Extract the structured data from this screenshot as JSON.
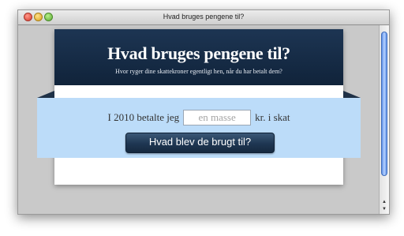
{
  "window": {
    "title": "Hvad bruges pengene til?"
  },
  "header": {
    "title": "Hvad bruges pengene til?",
    "subtitle": "Hvor ryger dine skattekroner egentligt hen, når du har betalt dem?"
  },
  "form": {
    "prefix": "I 2010 betalte jeg",
    "input_value": "",
    "input_placeholder": "en masse",
    "suffix": "kr. i skat",
    "submit_label": "Hvad blev de brugt til?"
  },
  "colors": {
    "header_bg": "#1a3050",
    "ribbon_bg": "#bcdcf9",
    "button_bg": "#1e3652"
  },
  "icons": {
    "close": "close-button-icon",
    "minimize": "minimize-button-icon",
    "maximize": "zoom-button-icon",
    "scroll_up": "scroll-up-arrow-icon",
    "scroll_down": "scroll-down-arrow-icon"
  }
}
